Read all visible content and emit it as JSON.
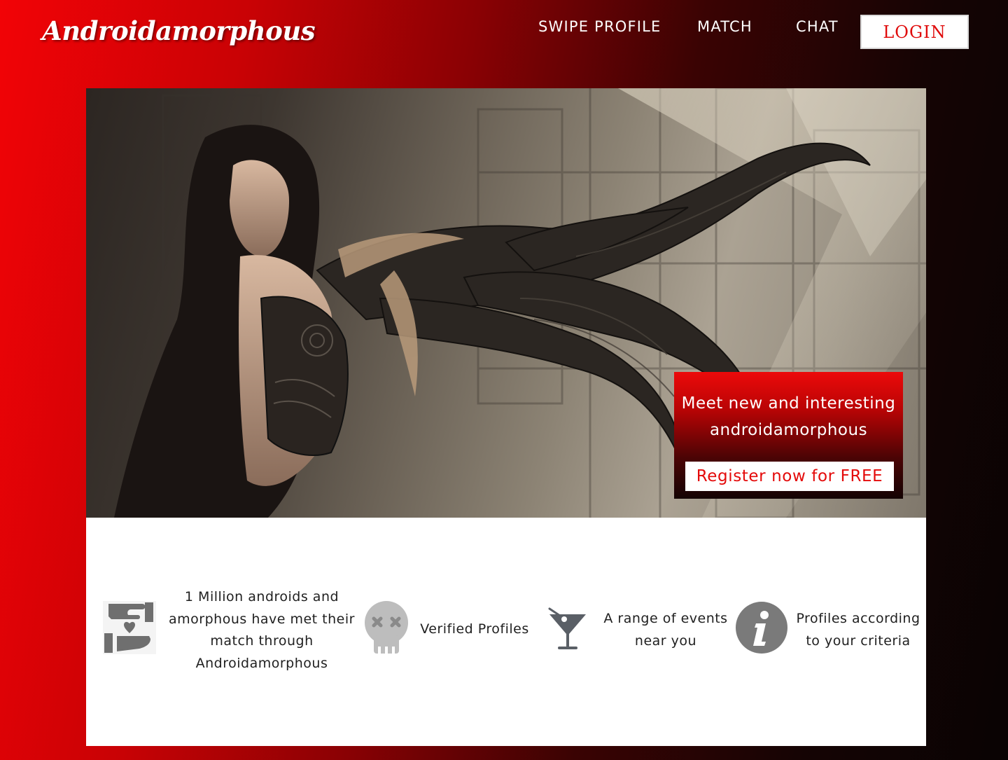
{
  "brand": {
    "name": "Androidamorphous"
  },
  "nav": {
    "items": [
      {
        "label": "SWIPE PROFILE"
      },
      {
        "label": "MATCH"
      },
      {
        "label": "CHAT"
      }
    ],
    "login_label": "LOGIN"
  },
  "hero": {
    "tagline_line1": "Meet new and interesting",
    "tagline_line2": "androidamorphous",
    "register_label": "Register now for FREE"
  },
  "features": [
    {
      "icon": "hands-heart-icon",
      "lines": [
        "1 Million androids and",
        "amorphous have met their",
        "match through",
        "Androidamorphous"
      ]
    },
    {
      "icon": "skull-icon",
      "lines": [
        "Verified Profiles"
      ]
    },
    {
      "icon": "cocktail-icon",
      "lines": [
        "A range of events",
        "near you"
      ]
    },
    {
      "icon": "info-icon",
      "lines": [
        "Profiles according",
        "to your criteria"
      ]
    }
  ],
  "colors": {
    "brand_red": "#e00b0b",
    "icon_gray": "#6f6f6f",
    "text_dark": "#1f1f1f"
  }
}
